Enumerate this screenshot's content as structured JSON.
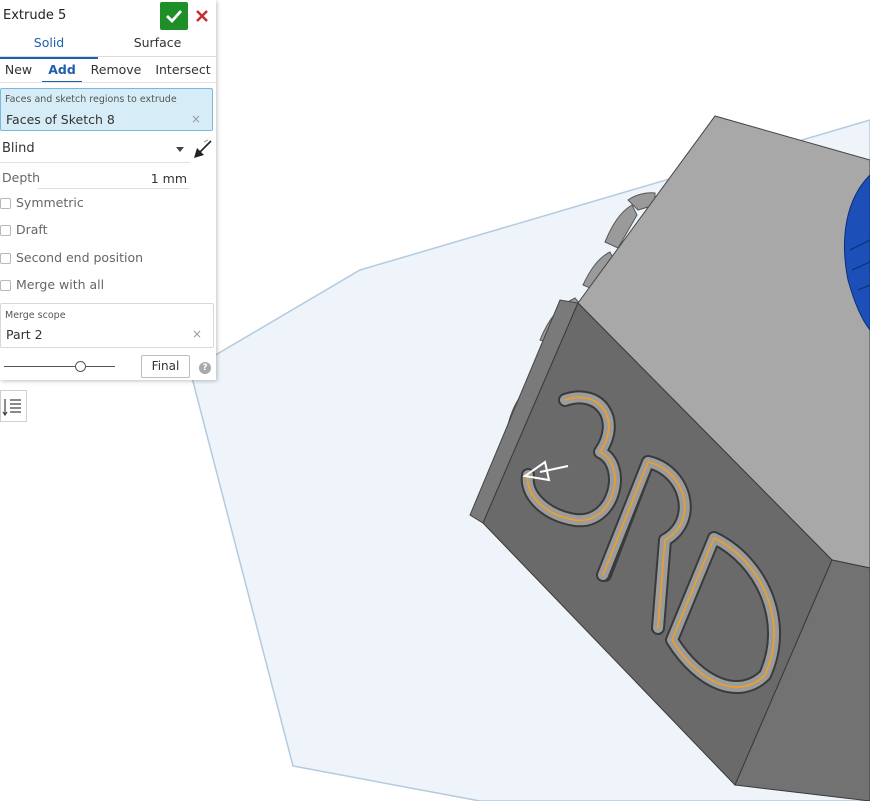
{
  "feature": {
    "title": "Extrude 5",
    "confirm_icon": "checkmark-icon",
    "cancel_icon": "close-icon",
    "colors": {
      "confirm": "#1e8f27",
      "cancel": "#c62f37",
      "active": "#1f5fad",
      "selection_bg": "#d6edf8"
    }
  },
  "body_types": [
    {
      "label": "Solid",
      "active": true
    },
    {
      "label": "Surface",
      "active": false
    }
  ],
  "operations": [
    {
      "label": "New",
      "active": false
    },
    {
      "label": "Add",
      "active": true
    },
    {
      "label": "Remove",
      "active": false
    },
    {
      "label": "Intersect",
      "active": false
    }
  ],
  "selection": {
    "label": "Faces and sketch regions to extrude",
    "value": "Faces of Sketch 8"
  },
  "end_type": {
    "value": "Blind",
    "flip_icon": "flip-direction-arrow-icon"
  },
  "depth": {
    "label": "Depth",
    "value": "1 mm"
  },
  "options": {
    "symmetric": {
      "label": "Symmetric",
      "checked": false
    },
    "draft": {
      "label": "Draft",
      "checked": false
    },
    "second_end": {
      "label": "Second end position",
      "checked": false
    },
    "merge_all": {
      "label": "Merge with all",
      "checked": false
    }
  },
  "merge_scope": {
    "label": "Merge scope",
    "value": "Part 2"
  },
  "footer": {
    "final_label": "Final",
    "preview_slider_value": 0.7,
    "help_icon": "?"
  },
  "model": {
    "text": "3RD",
    "colors": {
      "face_front": "#6a6a6a",
      "face_top": "#a8a8a8",
      "highlight": "#f0a020",
      "blue_part": "#1c50b8",
      "plane": "#eef4f9"
    }
  }
}
